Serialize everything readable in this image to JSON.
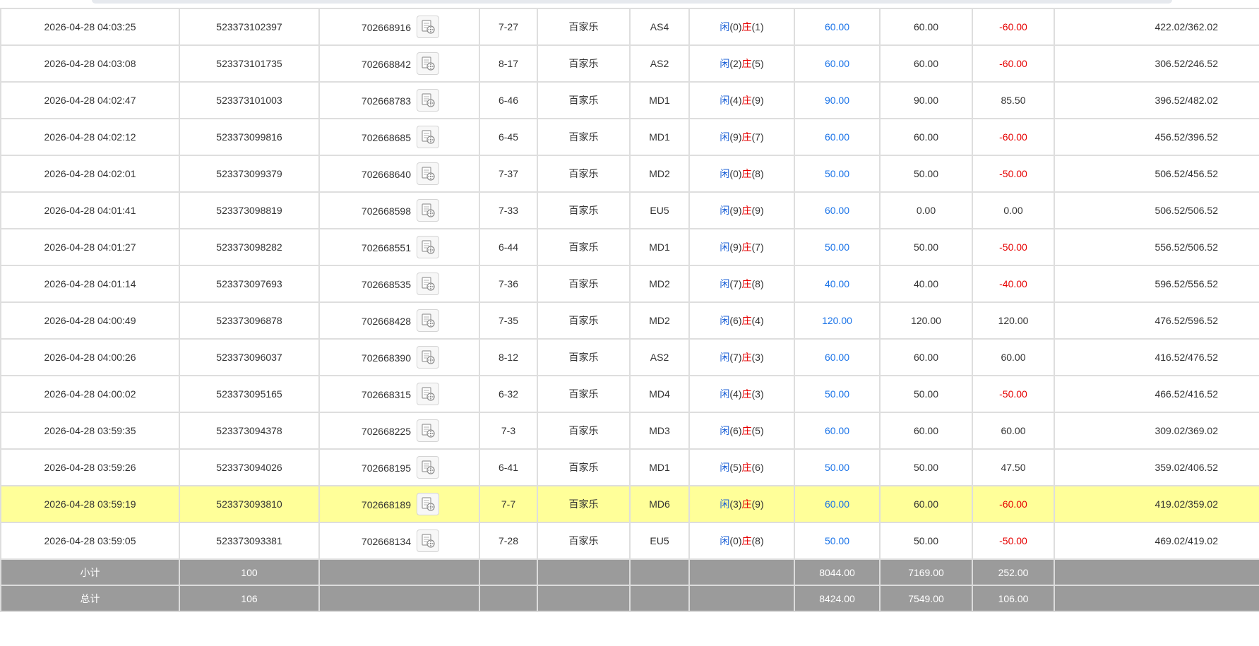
{
  "table": {
    "rows": [
      {
        "time": "2026-04-28 04:03:25",
        "bet_id": "523373102397",
        "round_id": "702668916",
        "shoe": "7-27",
        "game": "百家乐",
        "table": "AS4",
        "result": {
          "player_label": "闲",
          "player_val": "(0)",
          "banker_label": "庄",
          "banker_val": "(1)"
        },
        "bet": "60.00",
        "valid": "60.00",
        "win": "-60.00",
        "win_color": "red",
        "balance": "422.02/362.02"
      },
      {
        "time": "2026-04-28 04:03:08",
        "bet_id": "523373101735",
        "round_id": "702668842",
        "shoe": "8-17",
        "game": "百家乐",
        "table": "AS2",
        "result": {
          "player_label": "闲",
          "player_val": "(2)",
          "banker_label": "庄",
          "banker_val": "(5)"
        },
        "bet": "60.00",
        "valid": "60.00",
        "win": "-60.00",
        "win_color": "red",
        "balance": "306.52/246.52"
      },
      {
        "time": "2026-04-28 04:02:47",
        "bet_id": "523373101003",
        "round_id": "702668783",
        "shoe": "6-46",
        "game": "百家乐",
        "table": "MD1",
        "result": {
          "player_label": "闲",
          "player_val": "(4)",
          "banker_label": "庄",
          "banker_val": "(9)"
        },
        "bet": "90.00",
        "valid": "90.00",
        "win": "85.50",
        "win_color": "normal",
        "balance": "396.52/482.02"
      },
      {
        "time": "2026-04-28 04:02:12",
        "bet_id": "523373099816",
        "round_id": "702668685",
        "shoe": "6-45",
        "game": "百家乐",
        "table": "MD1",
        "result": {
          "player_label": "闲",
          "player_val": "(9)",
          "banker_label": "庄",
          "banker_val": "(7)"
        },
        "bet": "60.00",
        "valid": "60.00",
        "win": "-60.00",
        "win_color": "red",
        "balance": "456.52/396.52"
      },
      {
        "time": "2026-04-28 04:02:01",
        "bet_id": "523373099379",
        "round_id": "702668640",
        "shoe": "7-37",
        "game": "百家乐",
        "table": "MD2",
        "result": {
          "player_label": "闲",
          "player_val": "(0)",
          "banker_label": "庄",
          "banker_val": "(8)"
        },
        "bet": "50.00",
        "valid": "50.00",
        "win": "-50.00",
        "win_color": "red",
        "balance": "506.52/456.52"
      },
      {
        "time": "2026-04-28 04:01:41",
        "bet_id": "523373098819",
        "round_id": "702668598",
        "shoe": "7-33",
        "game": "百家乐",
        "table": "EU5",
        "result": {
          "player_label": "闲",
          "player_val": "(9)",
          "banker_label": "庄",
          "banker_val": "(9)"
        },
        "bet": "60.00",
        "valid": "0.00",
        "win": "0.00",
        "win_color": "normal",
        "balance": "506.52/506.52"
      },
      {
        "time": "2026-04-28 04:01:27",
        "bet_id": "523373098282",
        "round_id": "702668551",
        "shoe": "6-44",
        "game": "百家乐",
        "table": "MD1",
        "result": {
          "player_label": "闲",
          "player_val": "(9)",
          "banker_label": "庄",
          "banker_val": "(7)"
        },
        "bet": "50.00",
        "valid": "50.00",
        "win": "-50.00",
        "win_color": "red",
        "balance": "556.52/506.52"
      },
      {
        "time": "2026-04-28 04:01:14",
        "bet_id": "523373097693",
        "round_id": "702668535",
        "shoe": "7-36",
        "game": "百家乐",
        "table": "MD2",
        "result": {
          "player_label": "闲",
          "player_val": "(7)",
          "banker_label": "庄",
          "banker_val": "(8)"
        },
        "bet": "40.00",
        "valid": "40.00",
        "win": "-40.00",
        "win_color": "red",
        "balance": "596.52/556.52"
      },
      {
        "time": "2026-04-28 04:00:49",
        "bet_id": "523373096878",
        "round_id": "702668428",
        "shoe": "7-35",
        "game": "百家乐",
        "table": "MD2",
        "result": {
          "player_label": "闲",
          "player_val": "(6)",
          "banker_label": "庄",
          "banker_val": "(4)"
        },
        "bet": "120.00",
        "valid": "120.00",
        "win": "120.00",
        "win_color": "normal",
        "balance": "476.52/596.52"
      },
      {
        "time": "2026-04-28 04:00:26",
        "bet_id": "523373096037",
        "round_id": "702668390",
        "shoe": "8-12",
        "game": "百家乐",
        "table": "AS2",
        "result": {
          "player_label": "闲",
          "player_val": "(7)",
          "banker_label": "庄",
          "banker_val": "(3)"
        },
        "bet": "60.00",
        "valid": "60.00",
        "win": "60.00",
        "win_color": "normal",
        "balance": "416.52/476.52"
      },
      {
        "time": "2026-04-28 04:00:02",
        "bet_id": "523373095165",
        "round_id": "702668315",
        "shoe": "6-32",
        "game": "百家乐",
        "table": "MD4",
        "result": {
          "player_label": "闲",
          "player_val": "(4)",
          "banker_label": "庄",
          "banker_val": "(3)"
        },
        "bet": "50.00",
        "valid": "50.00",
        "win": "-50.00",
        "win_color": "red",
        "balance": "466.52/416.52"
      },
      {
        "time": "2026-04-28 03:59:35",
        "bet_id": "523373094378",
        "round_id": "702668225",
        "shoe": "7-3",
        "game": "百家乐",
        "table": "MD3",
        "result": {
          "player_label": "闲",
          "player_val": "(6)",
          "banker_label": "庄",
          "banker_val": "(5)"
        },
        "bet": "60.00",
        "valid": "60.00",
        "win": "60.00",
        "win_color": "normal",
        "balance": "309.02/369.02"
      },
      {
        "time": "2026-04-28 03:59:26",
        "bet_id": "523373094026",
        "round_id": "702668195",
        "shoe": "6-41",
        "game": "百家乐",
        "table": "MD1",
        "result": {
          "player_label": "闲",
          "player_val": "(5)",
          "banker_label": "庄",
          "banker_val": "(6)"
        },
        "bet": "50.00",
        "valid": "50.00",
        "win": "47.50",
        "win_color": "normal",
        "balance": "359.02/406.52"
      },
      {
        "time": "2026-04-28 03:59:19",
        "bet_id": "523373093810",
        "round_id": "702668189",
        "shoe": "7-7",
        "game": "百家乐",
        "table": "MD6",
        "result": {
          "player_label": "闲",
          "player_val": "(3)",
          "banker_label": "庄",
          "banker_val": "(9)"
        },
        "bet": "60.00",
        "valid": "60.00",
        "win": "-60.00",
        "win_color": "red",
        "balance": "419.02/359.02",
        "highlighted": true
      },
      {
        "time": "2026-04-28 03:59:05",
        "bet_id": "523373093381",
        "round_id": "702668134",
        "shoe": "7-28",
        "game": "百家乐",
        "table": "EU5",
        "result": {
          "player_label": "闲",
          "player_val": "(0)",
          "banker_label": "庄",
          "banker_val": "(8)"
        },
        "bet": "50.00",
        "valid": "50.00",
        "win": "-50.00",
        "win_color": "red",
        "balance": "469.02/419.02"
      }
    ],
    "subtotal": {
      "label": "小计",
      "count": "100",
      "bet": "8044.00",
      "valid": "7169.00",
      "win": "252.00"
    },
    "total": {
      "label": "总计",
      "count": "106",
      "bet": "8424.00",
      "valid": "7549.00",
      "win": "106.00"
    }
  },
  "icons": {
    "replay": "video-replay-icon"
  },
  "colors": {
    "bet_blue": "#1a73e8",
    "loss_red": "#e60000",
    "highlight": "#ffff99",
    "summary_bg": "#9b9b9b"
  }
}
